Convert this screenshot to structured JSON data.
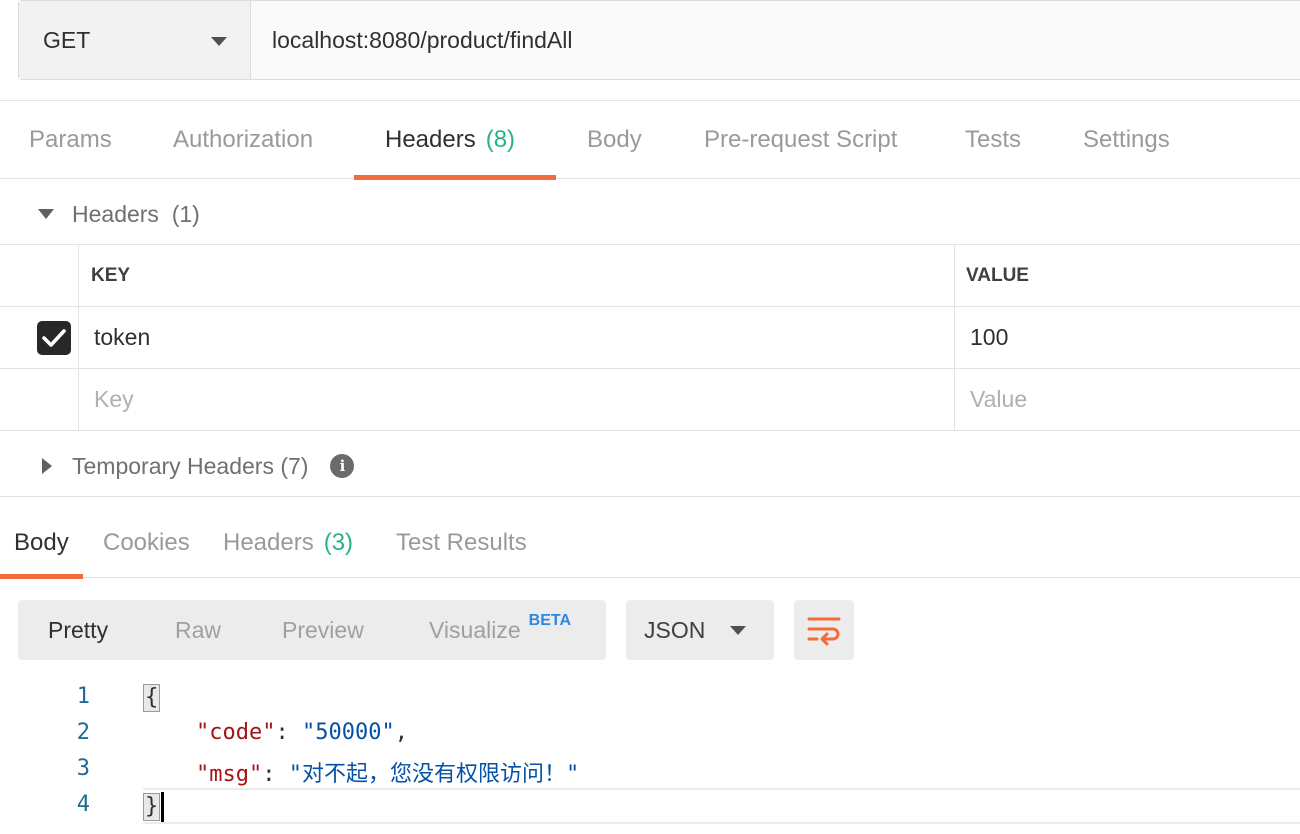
{
  "request": {
    "method": "GET",
    "url": "localhost:8080/product/findAll"
  },
  "request_tabs": [
    {
      "label": "Params"
    },
    {
      "label": "Authorization"
    },
    {
      "label": "Headers",
      "count": "(8)",
      "active": true
    },
    {
      "label": "Body"
    },
    {
      "label": "Pre-request Script"
    },
    {
      "label": "Tests"
    },
    {
      "label": "Settings"
    }
  ],
  "headers_section": {
    "title": "Headers",
    "count": "(1)",
    "columns": {
      "key": "KEY",
      "value": "VALUE"
    },
    "rows": [
      {
        "checked": true,
        "key": "token",
        "value": "100"
      }
    ],
    "placeholder": {
      "key": "Key",
      "value": "Value"
    }
  },
  "temporary_headers": {
    "title": "Temporary Headers",
    "count": "(7)",
    "info_icon": "i"
  },
  "response_tabs": [
    {
      "label": "Body",
      "active": true
    },
    {
      "label": "Cookies"
    },
    {
      "label": "Headers",
      "count": "(3)"
    },
    {
      "label": "Test Results"
    }
  ],
  "view_modes": [
    {
      "label": "Pretty",
      "active": true
    },
    {
      "label": "Raw"
    },
    {
      "label": "Preview"
    },
    {
      "label": "Visualize",
      "badge": "BETA"
    }
  ],
  "format": "JSON",
  "icons": {
    "wrap": "wrap-lines-icon",
    "caret": "chevron-down-icon",
    "check": "check-icon",
    "info": "info-icon"
  },
  "colors": {
    "accent": "#f26b3a",
    "count": "#26b47f",
    "beta": "#2f86e0"
  },
  "code": {
    "line_numbers": [
      "1",
      "2",
      "3",
      "4"
    ],
    "open_brace": "{",
    "close_brace": "}",
    "line2_key": "\"code\"",
    "line2_value": "\"50000\"",
    "line3_key": "\"msg\"",
    "line3_value": "\"对不起，您没有权限访问！\""
  }
}
